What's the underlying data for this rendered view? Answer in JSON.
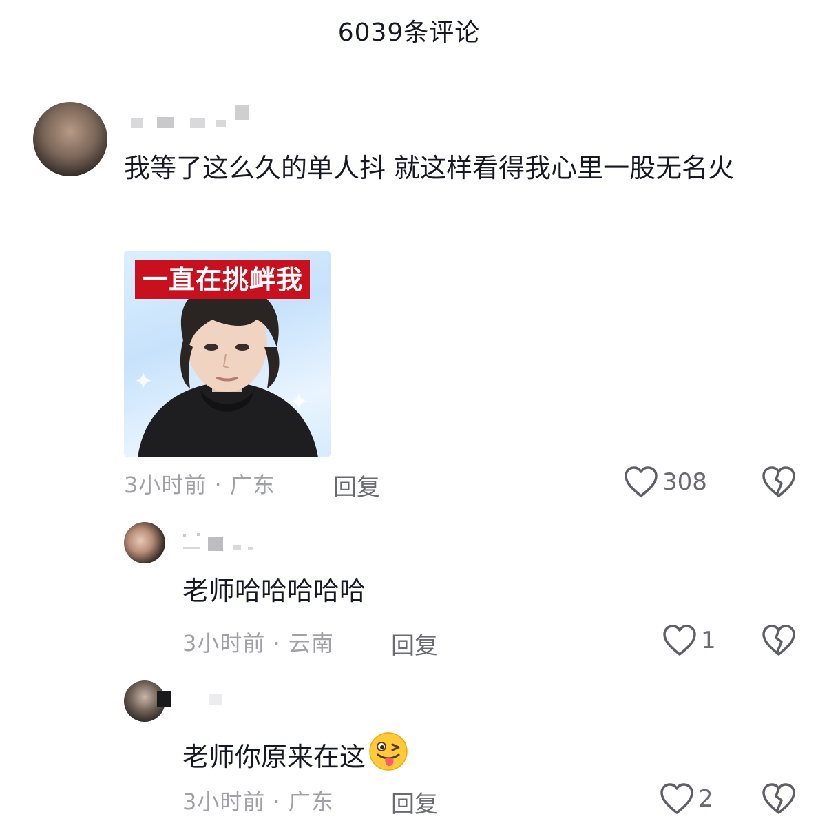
{
  "header": {
    "title": "6039条评论"
  },
  "comments": [
    {
      "text": "我等了这么久的单人抖 就这样看得我心里一股无名火",
      "sticker_caption": "一直在挑衅我",
      "meta": "3小时前 · 广东",
      "reply_label": "回复",
      "likes": "308"
    }
  ],
  "replies": [
    {
      "text": "老师哈哈哈哈哈",
      "meta": "3小时前 · 云南",
      "reply_label": "回复",
      "likes": "1"
    },
    {
      "text": "老师你原来在这",
      "emoji": "😜",
      "meta": "3小时前 · 广东",
      "reply_label": "回复",
      "likes": "2"
    }
  ],
  "icons": {
    "like": "heart-outline-icon",
    "dislike": "broken-heart-icon"
  },
  "colors": {
    "text_primary": "#161823",
    "text_secondary": "#a0a1a6",
    "action": "#6a6b72",
    "sticker_banner": "#c8101e"
  }
}
